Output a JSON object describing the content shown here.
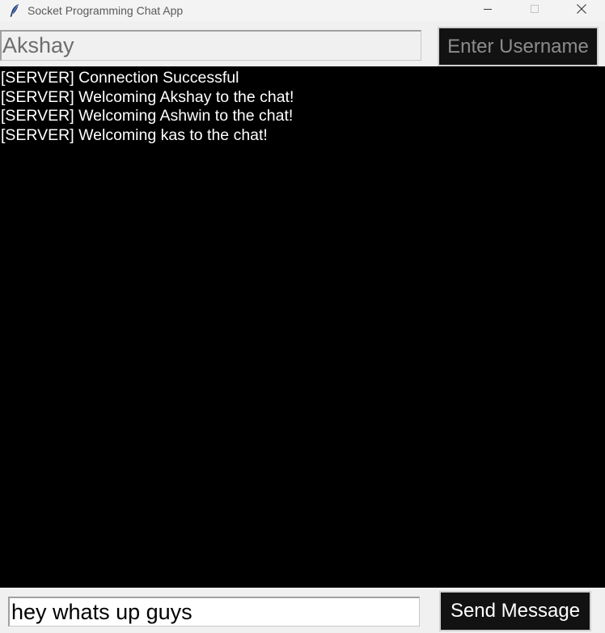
{
  "window": {
    "title": "Socket Programming Chat App",
    "controls": {
      "minimize_icon": "minimize-icon",
      "maximize_icon": "maximize-icon",
      "close_icon": "close-icon"
    }
  },
  "app_icon": "feather-icon",
  "username": {
    "value": "Akshay",
    "button_label": "Enter Username"
  },
  "messages": [
    "[SERVER] Connection Successful",
    "[SERVER] Welcoming Akshay to the chat!",
    "[SERVER] Welcoming Ashwin to the chat!",
    "[SERVER] Welcoming kas to the chat!"
  ],
  "composer": {
    "value": "hey whats up guys",
    "button_label": "Send Message"
  },
  "colors": {
    "message_area_bg": "#000000",
    "message_text": "#ffffff",
    "button_bg": "#121212",
    "window_bg": "#f0f0f0"
  }
}
